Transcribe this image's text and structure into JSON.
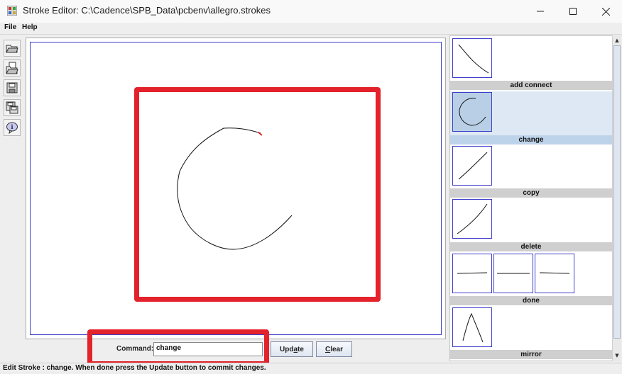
{
  "window": {
    "title": "Stroke Editor: C:\\Cadence\\SPB_Data\\pcbenv\\allegro.strokes",
    "controls": {
      "minimize": "—",
      "maximize": "☐",
      "close": "✕"
    }
  },
  "menu": {
    "file": "File",
    "help": "Help"
  },
  "toolbar": {
    "items": [
      {
        "name": "open-folder-icon"
      },
      {
        "name": "open-file-icon"
      },
      {
        "name": "save-icon"
      },
      {
        "name": "save-as-icon"
      },
      {
        "name": "info-icon"
      }
    ]
  },
  "command": {
    "label": "Command:",
    "value": "change",
    "update_label": "Update",
    "clear_label": "Clear"
  },
  "strokes": [
    {
      "label": "add connect",
      "selected": false
    },
    {
      "label": "change",
      "selected": true
    },
    {
      "label": "copy",
      "selected": false
    },
    {
      "label": "delete",
      "selected": false
    },
    {
      "label": "done",
      "selected": false
    },
    {
      "label": "mirror",
      "selected": false
    }
  ],
  "status": "Edit Stroke : change. When done press the Update button to commit changes.",
  "colors": {
    "highlight": "#e3222b",
    "selection": "#bdd3ea",
    "border_blue": "#3d3dc8"
  }
}
